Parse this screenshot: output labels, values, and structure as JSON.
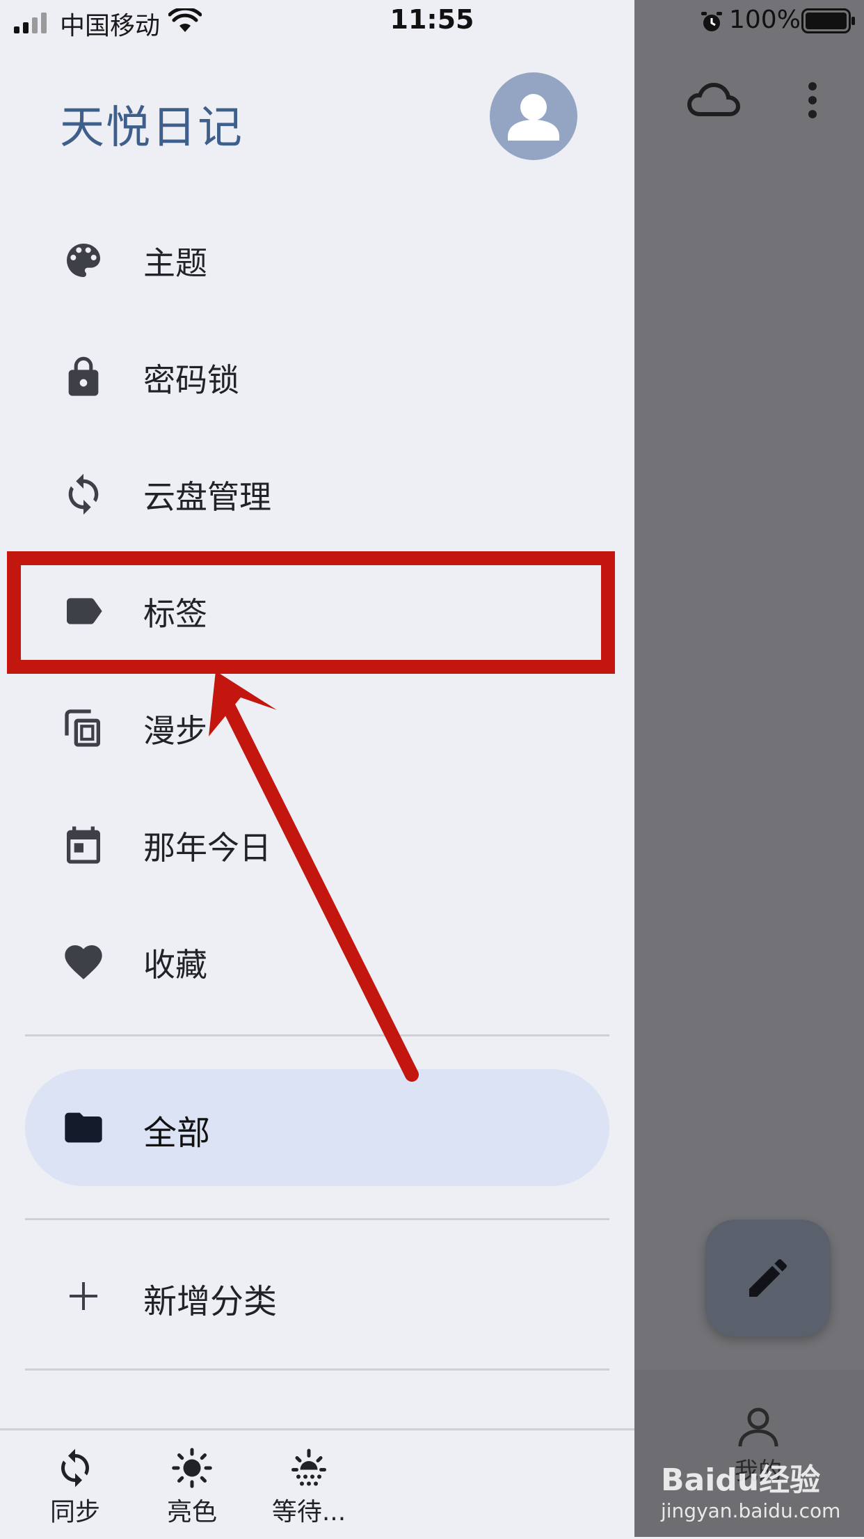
{
  "status_bar": {
    "carrier": "中国移动",
    "time": "11:55",
    "battery": "100%"
  },
  "drawer": {
    "app_title": "天悦日记",
    "menu": [
      {
        "label": "主题",
        "icon": "palette-icon"
      },
      {
        "label": "密码锁",
        "icon": "lock-icon"
      },
      {
        "label": "云盘管理",
        "icon": "sync-icon"
      },
      {
        "label": "标签",
        "icon": "label-icon"
      },
      {
        "label": "漫步",
        "icon": "copy-icon"
      },
      {
        "label": "那年今日",
        "icon": "calendar-icon"
      },
      {
        "label": "收藏",
        "icon": "heart-icon"
      }
    ],
    "selected_category": {
      "label": "全部",
      "icon": "folder-icon"
    },
    "add_category": {
      "label": "新增分类",
      "icon": "plus-icon"
    },
    "bottom_bar": [
      {
        "label": "同步",
        "icon": "sync-icon"
      },
      {
        "label": "亮色",
        "icon": "sun-icon"
      },
      {
        "label": "等待...",
        "icon": "sunset-icon"
      }
    ]
  },
  "main": {
    "me_tab_label": "我的"
  },
  "watermark": {
    "logo": "Baidu经验",
    "url": "jingyan.baidu.com"
  },
  "colors": {
    "accent_title": "#3e5f8a",
    "highlight_red": "#c3160e",
    "selected_bg": "#dbe3f5",
    "scrim": "#737377"
  }
}
